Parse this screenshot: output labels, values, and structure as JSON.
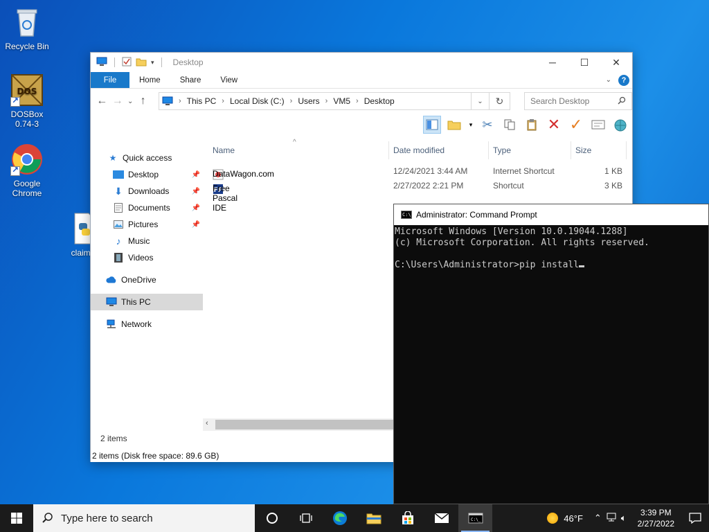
{
  "desktop": {
    "icons": [
      {
        "label": "Recycle Bin"
      },
      {
        "label": "DOSBox 0.74-3"
      },
      {
        "label": "Google Chrome"
      },
      {
        "label": "claime"
      }
    ]
  },
  "explorer": {
    "title": "Desktop",
    "tabs": [
      "File",
      "Home",
      "Share",
      "View"
    ],
    "path": [
      "This PC",
      "Local Disk (C:)",
      "Users",
      "VM5",
      "Desktop"
    ],
    "search_placeholder": "Search Desktop",
    "nav": [
      {
        "label": "Quick access",
        "icon": "star-icon"
      },
      {
        "label": "Desktop",
        "icon": "desktop-folder-icon",
        "pinned": true
      },
      {
        "label": "Downloads",
        "icon": "download-arrow-icon",
        "pinned": true
      },
      {
        "label": "Documents",
        "icon": "document-icon",
        "pinned": true
      },
      {
        "label": "Pictures",
        "icon": "picture-icon",
        "pinned": true
      },
      {
        "label": "Music",
        "icon": "music-note-icon"
      },
      {
        "label": "Videos",
        "icon": "film-icon"
      },
      {
        "label": "OneDrive",
        "icon": "cloud-icon"
      },
      {
        "label": "This PC",
        "icon": "monitor-icon",
        "selected": true
      },
      {
        "label": "Network",
        "icon": "network-icon"
      }
    ],
    "columns": [
      "Name",
      "Date modified",
      "Type",
      "Size"
    ],
    "files": [
      {
        "name": "DataWagon.com",
        "date": "12/24/2021 3:44 AM",
        "type": "Internet Shortcut",
        "size": "1 KB"
      },
      {
        "name": "Free Pascal IDE",
        "date": "2/27/2022 2:21 PM",
        "type": "Shortcut",
        "size": "3 KB"
      }
    ],
    "item_count": "2 items",
    "status": "2 items (Disk free space: 89.6 GB)"
  },
  "cmd": {
    "title": "Administrator: Command Prompt",
    "line1": "Microsoft Windows [Version 10.0.19044.1288]",
    "line2": "(c) Microsoft Corporation. All rights reserved.",
    "prompt": "C:\\Users\\Administrator>",
    "input": "pip install"
  },
  "taskbar": {
    "search_placeholder": "Type here to search",
    "temperature": "46°F",
    "time": "3:39 PM",
    "date": "2/27/2022"
  }
}
